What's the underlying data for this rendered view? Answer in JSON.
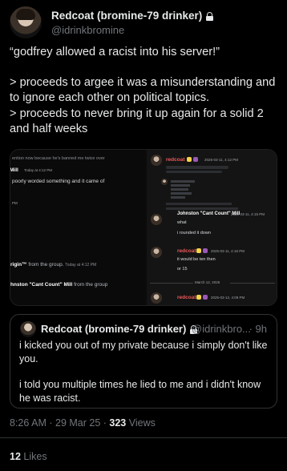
{
  "author": {
    "display_name": "Redcoat (bromine-79 drinker)",
    "handle": "@idrinkbromine"
  },
  "tweet": {
    "paragraphs": [
      "“godfrey allowed a racist into his server!”",
      "> proceeds to argee it was a misunderstanding and to ignore each other on political topics.",
      "> proceeds to never bring it up again for a  solid 2 and half weeks"
    ]
  },
  "media": {
    "left": {
      "line1": "ention now because he's banned me twice over",
      "name1": "Mill",
      "time1": "Today at 4:12 PM",
      "line2": "poorly worded something and it came of",
      "line3": "PM",
      "join1_name": "rigin™",
      "join1_text": "from the group.",
      "join1_time": "Today at 4:12 PM",
      "join2_name": "hnston \"Cant Count\" Mill",
      "join2_text": "from the group"
    },
    "right": {
      "user1": "redcoat",
      "time1": "2025-03-11, 4:12 PM",
      "name2": "Johnston \"Cant Count\" Mill",
      "time2": "2025-03-11, 4:15 PM",
      "msg_what": "what",
      "msg_round": "i rounded it down",
      "user3": "redcoat",
      "time3": "2025-03-11, 4:16 PM",
      "msg_ten": "it would be ten then",
      "msg_15": "or 15",
      "date_sep": "March 12, 2025",
      "user4": "redcoat",
      "time4": "2025-03-12, 4:09 PM"
    }
  },
  "quote": {
    "display_name": "Redcoat (bromine-79 drinker)",
    "handle": "@idrinkbro...",
    "time": "· 9h",
    "paragraphs": [
      "i kicked you out of my private because i simply don't like you.",
      "i told you multiple times he lied to me and i didn't know he was racist."
    ]
  },
  "meta": {
    "time": "8:26 AM",
    "date": "29 Mar 25",
    "views_count": "323",
    "views_label": "Views"
  },
  "likes": {
    "count": "12",
    "label": "Likes"
  }
}
